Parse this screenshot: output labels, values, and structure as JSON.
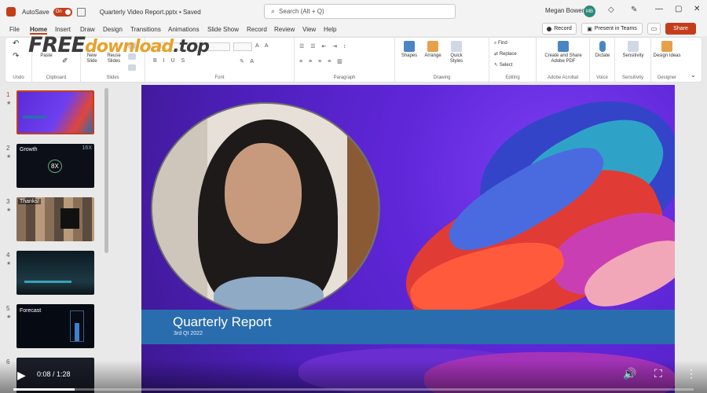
{
  "titlebar": {
    "autosave_label": "AutoSave",
    "autosave_state": "On",
    "doc_title": "Quarterly Video Report.pptx • Saved",
    "search_placeholder": "Search (Alt + Q)",
    "user_name": "Megan Bowen",
    "user_initials": "MB"
  },
  "menu": {
    "tabs": [
      "File",
      "Home",
      "Insert",
      "Draw",
      "Design",
      "Transitions",
      "Animations",
      "Slide Show",
      "Record",
      "Review",
      "View",
      "Help"
    ],
    "active_tab": "Home",
    "record_label": "Record",
    "present_label": "Present in Teams",
    "share_label": "Share"
  },
  "ribbon": {
    "groups": [
      "Undo",
      "Clipboard",
      "Slides",
      "Font",
      "Paragraph",
      "Drawing",
      "Editing",
      "Adobe Acrobat",
      "Voice",
      "Sensitivity",
      "Designer"
    ],
    "buttons": {
      "paste": "Paste",
      "new_slide": "New Slide",
      "reuse_slides": "Reuse Slides",
      "shapes": "Shapes",
      "arrange": "Arrange",
      "quick_styles": "Quick Styles",
      "find": "Find",
      "replace": "Replace",
      "select": "Select",
      "create_share_pdf": "Create and Share Adobe PDF",
      "dictate": "Dictate",
      "sensitivity": "Sensitivity",
      "design_ideas": "Design Ideas"
    }
  },
  "watermark": {
    "free": "FREE",
    "download": "download",
    "top": ".top"
  },
  "thumbnails": [
    {
      "number": "1",
      "title": ""
    },
    {
      "number": "2",
      "title": "Growth",
      "badge": "8X",
      "corner": "16X"
    },
    {
      "number": "3",
      "title": "Thanks!"
    },
    {
      "number": "4",
      "title": ""
    },
    {
      "number": "5",
      "title": "Forecast"
    },
    {
      "number": "6",
      "title": ""
    }
  ],
  "slide": {
    "title": "Quarterly Report",
    "subtitle": "3rd Qt 2022"
  },
  "video": {
    "timecode": "0:08 / 1:28",
    "progress_fraction": 0.09
  },
  "colors": {
    "accent": "#c43e1c",
    "slide_bg": "#5f26d8",
    "title_band": "#2a6dae"
  }
}
